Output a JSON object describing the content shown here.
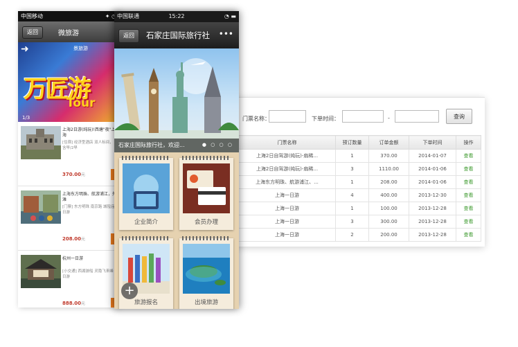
{
  "phone_left": {
    "status": {
      "carrier": "中国移动",
      "icons": "✦ ◔"
    },
    "back_label": "返回",
    "title": "微旅游",
    "banner": {
      "caption": "景旅游",
      "art_text": "万匠游",
      "art_subtext": "Tour",
      "index": "1/3"
    },
    "items": [
      {
        "title": "上海2日游(纯玩)!西塘\"夜\"上海",
        "desc": "[住宿] 经济型酒店 双人标间，含早/2早",
        "price": "370.00",
        "unit": "元"
      },
      {
        "title": "上海东方明珠、航游浦江，外滩",
        "desc": "[门票] 东方明珠 南京路 城隍庙 日游",
        "price": "208.00",
        "unit": "元"
      },
      {
        "title": "杭州一日游",
        "desc": "[小交通] 西湖游船 灵隐飞来峰 日游",
        "price": "888.00",
        "unit": "元"
      }
    ]
  },
  "phone_mid": {
    "status": {
      "carrier": "中国联通",
      "time": "15:22",
      "icons": "◔ ▬"
    },
    "back_label": "返回",
    "title": "石家庄国际旅行社",
    "more_icon": "•••",
    "banner_caption": "石家庄国际旅行社，欢迎...",
    "banner_dots": "● ○ ○ ○",
    "tiles": [
      {
        "label": "企业简介"
      },
      {
        "label": "会员办理"
      },
      {
        "label": "旅游报名"
      },
      {
        "label": "出境旅游"
      }
    ]
  },
  "admin": {
    "search": {
      "ticket_label": "门票名称：",
      "time_label": "下单时间：",
      "range_sep": "-",
      "query_button": "查询"
    },
    "columns": [
      "门票名称",
      "预订数量",
      "订单金额",
      "下单时间",
      "操作"
    ],
    "rows": [
      {
        "name": "上海2日自驾游(纯玩)-扇稀...",
        "qty": "1",
        "amount": "370.00",
        "date": "2014-01-07",
        "action": "查看"
      },
      {
        "name": "上海2日自驾游(纯玩)-扇稀...",
        "qty": "3",
        "amount": "1110.00",
        "date": "2014-01-06",
        "action": "查看"
      },
      {
        "name": "上海东方明珠、航游浦江、...",
        "qty": "1",
        "amount": "208.00",
        "date": "2014-01-06",
        "action": "查看"
      },
      {
        "name": "上海一日游",
        "qty": "4",
        "amount": "400.00",
        "date": "2013-12-30",
        "action": "查看"
      },
      {
        "name": "上海一日游",
        "qty": "1",
        "amount": "100.00",
        "date": "2013-12-28",
        "action": "查看"
      },
      {
        "name": "上海一日游",
        "qty": "3",
        "amount": "300.00",
        "date": "2013-12-28",
        "action": "查看"
      },
      {
        "name": "上海一日游",
        "qty": "2",
        "amount": "200.00",
        "date": "2013-12-28",
        "action": "查看"
      }
    ]
  },
  "colors": {
    "accent_orange": "#f07d1e",
    "price_red": "#c0392b",
    "link_green": "#3d9a2e"
  }
}
